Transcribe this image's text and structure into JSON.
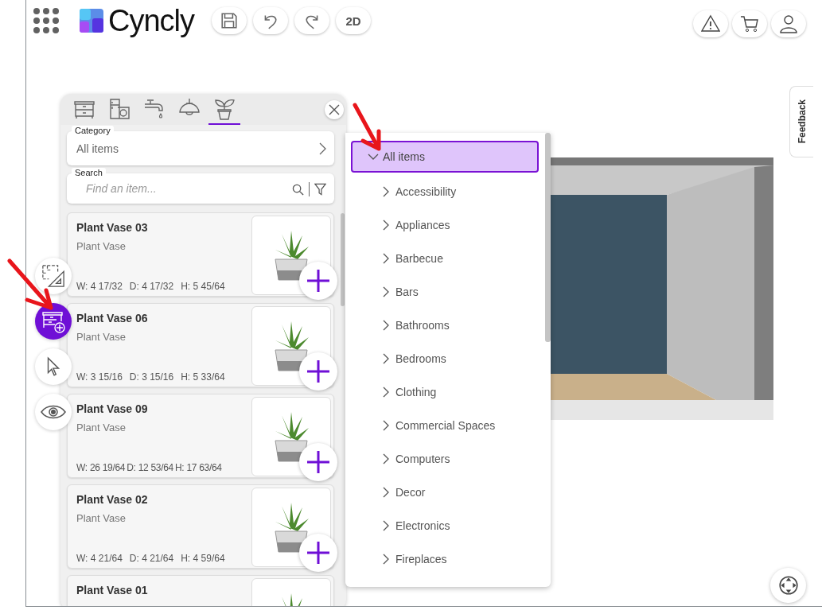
{
  "app": {
    "logo": "Cyncly",
    "view_toggle": "2D",
    "feedback": "Feedback"
  },
  "side_tools": [
    {
      "kind": "floorplan",
      "selected": false
    },
    {
      "kind": "add-furniture",
      "selected": true
    },
    {
      "kind": "pointer",
      "selected": false
    },
    {
      "kind": "eye",
      "selected": false
    }
  ],
  "catalog": {
    "tabs": [
      {
        "kind": "dresser",
        "selected": false
      },
      {
        "kind": "appliance",
        "selected": false
      },
      {
        "kind": "faucet",
        "selected": false
      },
      {
        "kind": "lamp",
        "selected": false
      },
      {
        "kind": "plant",
        "selected": true
      }
    ],
    "category": {
      "label": "Category",
      "value": "All items"
    },
    "search": {
      "label": "Search",
      "placeholder": "Find an item..."
    },
    "items": [
      {
        "name": "Plant Vase 03",
        "type": "Plant Vase",
        "dims": [
          "W: 4 17/32",
          "D: 4 17/32",
          "H: 5 45/64"
        ]
      },
      {
        "name": "Plant Vase 06",
        "type": "Plant Vase",
        "dims": [
          "W: 3 15/16",
          "D: 3 15/16",
          "H: 5 33/64"
        ]
      },
      {
        "name": "Plant Vase 09",
        "type": "Plant Vase",
        "dims": [
          "W: 26 19/64",
          "D: 12 53/64",
          "H: 17 63/64"
        ]
      },
      {
        "name": "Plant Vase 02",
        "type": "Plant Vase",
        "dims": [
          "W: 4 21/64",
          "D: 4 21/64",
          "H: 4 59/64"
        ]
      },
      {
        "name": "Plant Vase 01"
      }
    ]
  },
  "category_tree": {
    "items": [
      {
        "label": "All items",
        "expanded": true,
        "selected": true,
        "children": [
          {
            "label": "Accessibility",
            "expanded": false,
            "selected": false
          },
          {
            "label": "Appliances",
            "expanded": false,
            "selected": false
          },
          {
            "label": "Barbecue",
            "expanded": false,
            "selected": false
          },
          {
            "label": "Bars",
            "expanded": false,
            "selected": false
          },
          {
            "label": "Bathrooms",
            "expanded": false,
            "selected": false
          },
          {
            "label": "Bedrooms",
            "expanded": false,
            "selected": false
          },
          {
            "label": "Clothing",
            "expanded": false,
            "selected": false
          },
          {
            "label": "Commercial Spaces",
            "expanded": false,
            "selected": false
          },
          {
            "label": "Computers",
            "expanded": false,
            "selected": false
          },
          {
            "label": "Decor",
            "expanded": false,
            "selected": false
          },
          {
            "label": "Electronics",
            "expanded": false,
            "selected": false
          },
          {
            "label": "Fireplaces",
            "expanded": false,
            "selected": false
          }
        ]
      }
    ]
  }
}
